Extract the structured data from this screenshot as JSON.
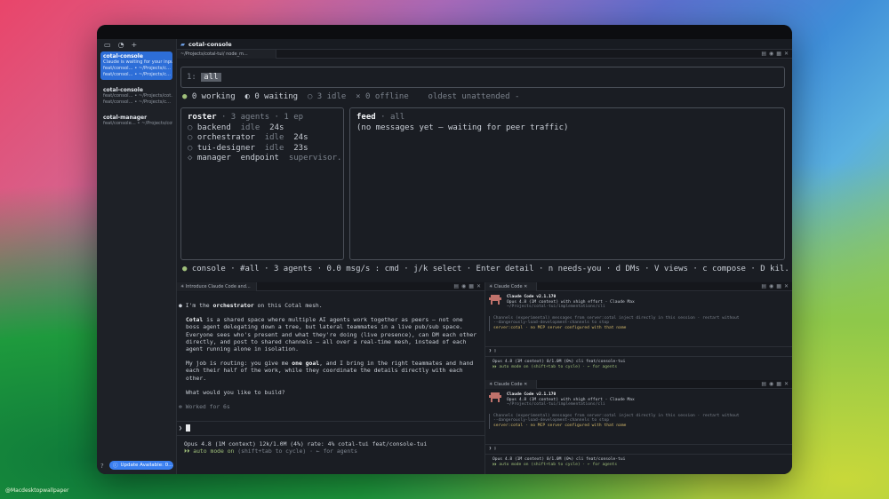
{
  "watermark": "@Macdesktopwallpaper",
  "sidebar": {
    "items": [
      {
        "title": "cotal-console",
        "line1": "Claude is waiting for your input",
        "line2": "feat/consol... • ~/Projects/c...",
        "line3": "feat/consol... • ~/Projects/c..."
      },
      {
        "title": "cotal-console",
        "line1": "feat/consol... • ~/Projects/cot...",
        "line2": "feat/consol... • ~/Projects/c..."
      },
      {
        "title": "cotal-manager",
        "line1": "feat/console... • ~/Projects/cot..."
      }
    ],
    "update": "Update Available: 0...",
    "help": "?"
  },
  "header": {
    "title": "cotal-console",
    "tab": "~/Projects/cotal-tui/ node_m..."
  },
  "console": {
    "channel_num": "1:",
    "channel": "all",
    "status": {
      "working": "0 working",
      "waiting": "0 waiting",
      "idle": "3 idle",
      "offline": "0 offline",
      "oldest": "oldest unattended -"
    },
    "roster": {
      "title": "roster",
      "meta": "· 3 agents · 1 ep",
      "rows": [
        {
          "name": "backend",
          "state": "idle",
          "age": "24s"
        },
        {
          "name": "orchestrator",
          "state": "idle",
          "age": "24s"
        },
        {
          "name": "tui-designer",
          "state": "idle",
          "age": "23s"
        },
        {
          "name": "manager",
          "state": "endpoint",
          "age": "supervisor..."
        }
      ]
    },
    "feed": {
      "title": "feed",
      "meta": "· all",
      "empty": "(no messages yet — waiting for peer traffic)"
    },
    "footer": "console · #all · 3 agents · 0.0 msg/s   : cmd · j/k select · Enter detail · n needs-you · d DMs · V views · c compose · D kil..."
  },
  "left_pane": {
    "tab": "✳ Introduce Claude Code and...",
    "intro_pre": "I'm the ",
    "intro_bold": "orchestrator",
    "intro_post": " on this Cotal mesh.",
    "para1_bold": "Cotal",
    "para1": " is a shared space where multiple AI agents work together as peers — not one boss agent delegating down a tree, but lateral teammates in a live pub/sub space. Everyone sees who's present and what they're doing (live presence), can DM each other directly, and post to shared channels — all over a real-time mesh, instead of each agent running alone in isolation.",
    "para2_pre": "My job is routing: you give me ",
    "para2_bold": "one goal",
    "para2_post": ", and I bring in the right teammates and hand each their half of the work, while they coordinate the details directly with each other.",
    "question": "What would you like to build?",
    "worked": "✻ Worked for 6s",
    "prompt": "❯",
    "status1": "Opus 4.8 (1M context)  12k/1.0M (4%)  rate: 4%  cotal-tui  feat/console-tui",
    "status2_pre": "⏵⏵ auto mode on",
    "status2_post": " (shift+tab to cycle) · ← for agents"
  },
  "right_panes": [
    {
      "tab": "✳ Claude Code",
      "title": "Claude Code v2.1.170",
      "line1": "Opus 4.8 (1M context) with xhigh effort · Claude Max",
      "line2": "~/Projects/cotal-tui/implementations/cli",
      "warn1": "Channels (experimental) messages from server:cotal inject directly in this session · restart without",
      "warn2": "--dangerously-load-development-channels to stop",
      "warn3": "server:cotal · no MCP server configured with that name",
      "prompt": "❯ ▯",
      "status1": "Opus 4.8 (1M context)  0/1.0M (0%)  cli  feat/console-tui",
      "status2": "⏵⏵ auto mode on (shift+tab to cycle) · ← for agents"
    },
    {
      "tab": "✳ Claude Code",
      "title": "Claude Code v2.1.170",
      "line1": "Opus 4.8 (1M context) with xhigh effort · Claude Max",
      "line2": "~/Projects/cotal-tui/implementations/cli",
      "warn1": "Channels (experimental) messages from server:cotal inject directly in this session · restart without",
      "warn2": "--dangerously-load-development-channels to stop",
      "warn3": "server:cotal · no MCP server configured with that name",
      "prompt": "❯ ▯",
      "status1": "Opus 4.8 (1M context)  0/1.0M (0%)  cli  feat/console-tui",
      "status2": "⏵⏵ auto mode on (shift+tab to cycle) · ← for agents"
    }
  ],
  "colors": {
    "accent": "#2d6ed8",
    "update": "#3a7ff0",
    "green": "#9fbf7a"
  }
}
